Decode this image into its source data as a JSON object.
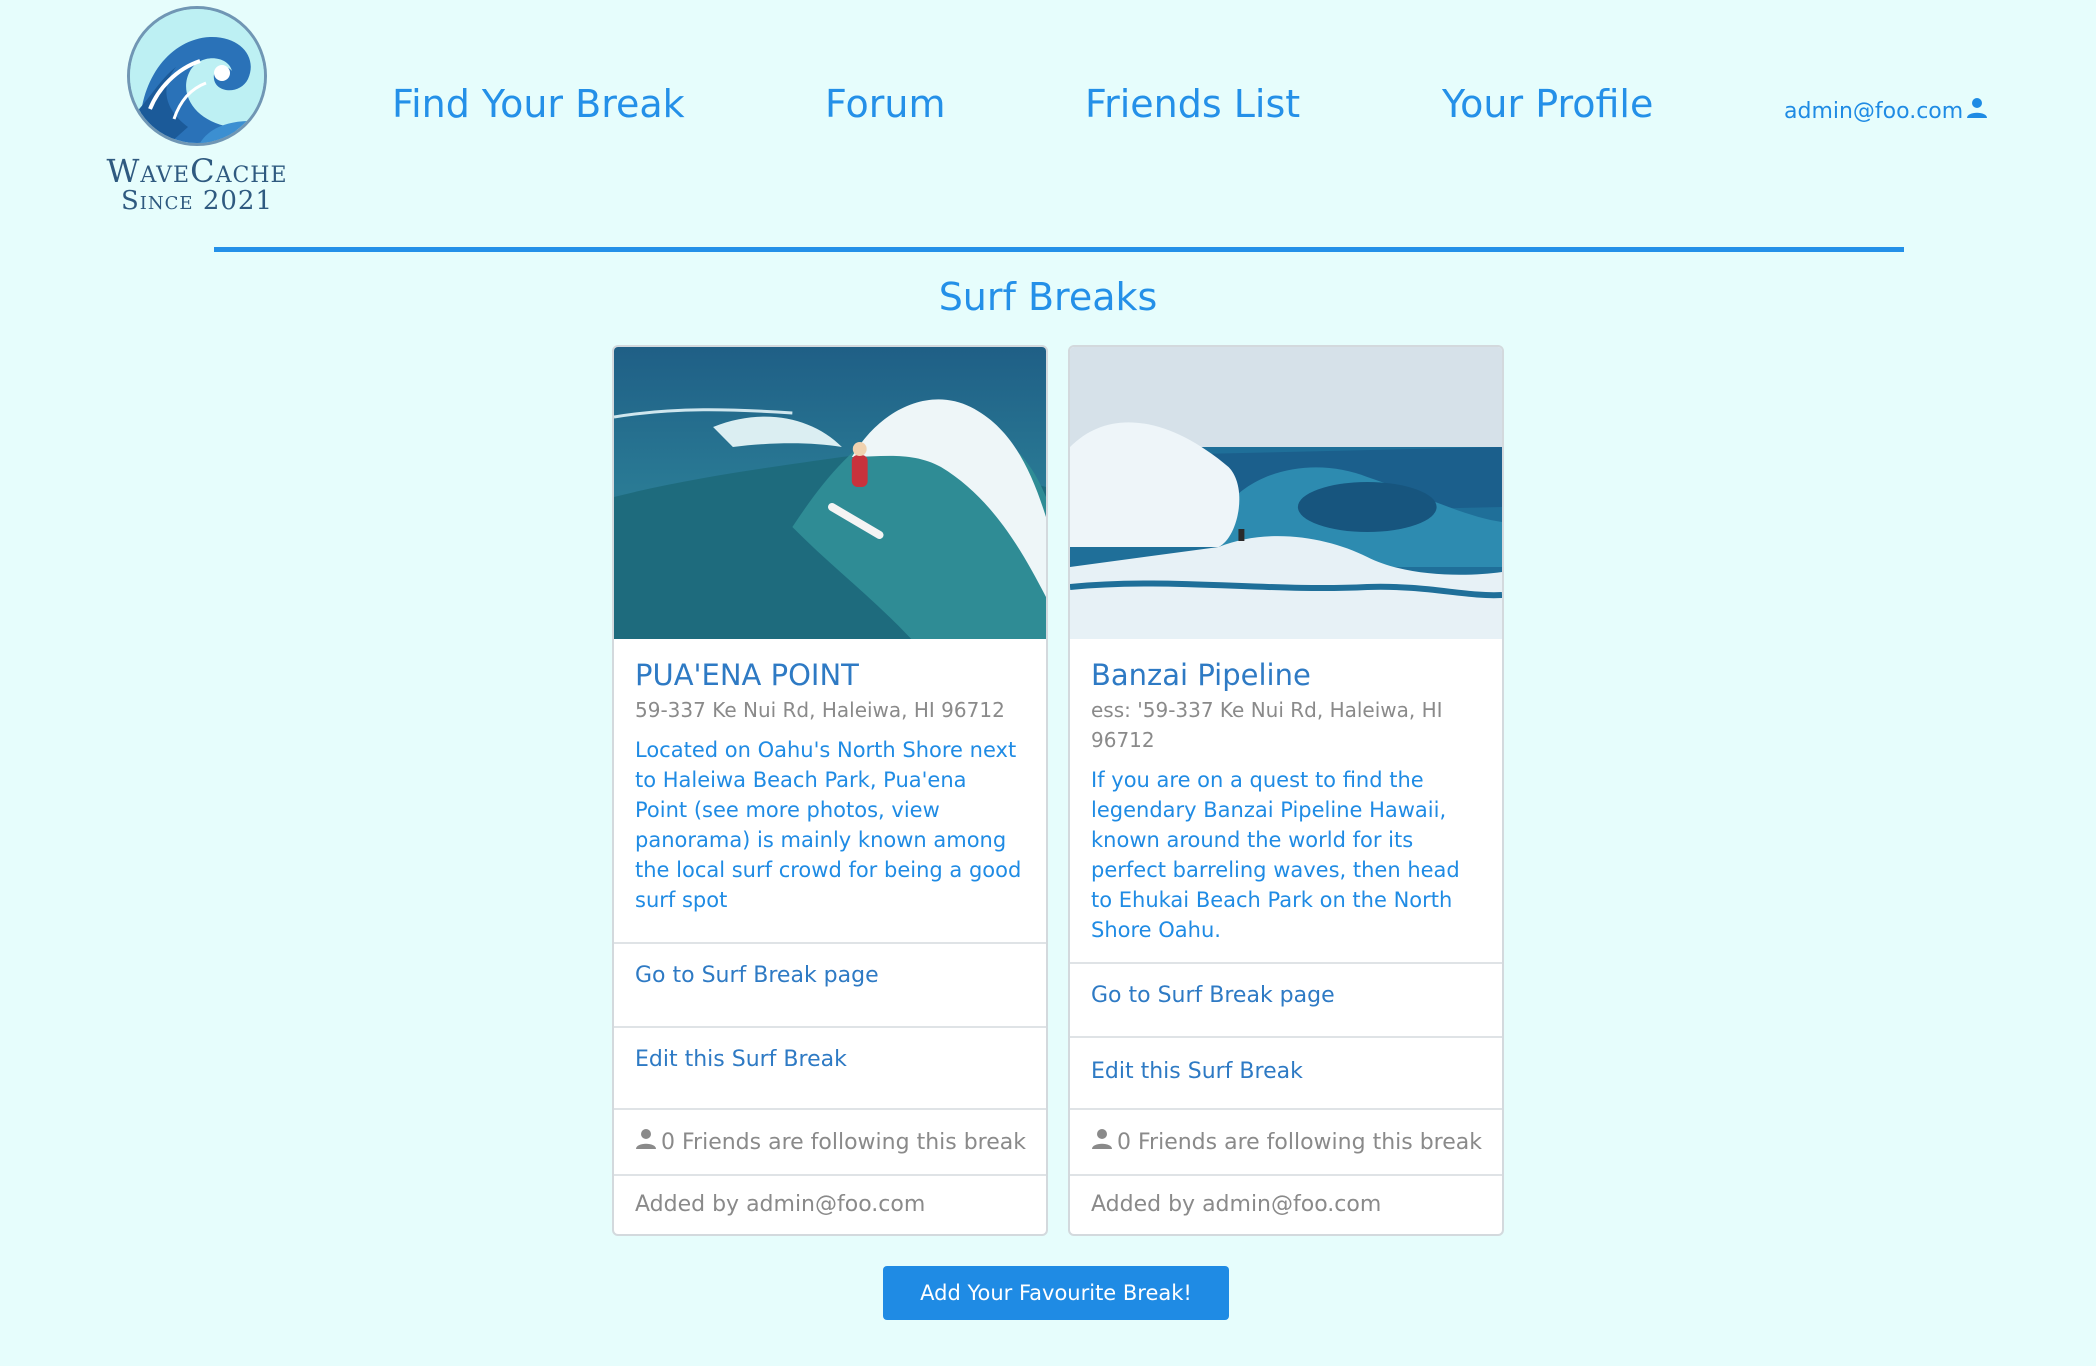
{
  "brand": {
    "name": "WaveCache",
    "tagline": "Since 2021",
    "colors": {
      "primary": "#2490e8",
      "background": "#e6fdfc"
    }
  },
  "nav": {
    "items": [
      {
        "label": "Find Your Break"
      },
      {
        "label": "Forum"
      },
      {
        "label": "Friends List"
      },
      {
        "label": "Your Profile"
      }
    ],
    "user": {
      "email": "admin@foo.com",
      "icon": "user-icon"
    }
  },
  "page": {
    "title": "Surf Breaks"
  },
  "cards": [
    {
      "title": "PUA'ENA POINT",
      "address": "59-337 Ke Nui Rd, Haleiwa, HI 96712",
      "description": "Located on Oahu's North Shore next to Haleiwa Beach Park, Pua'ena Point (see more photos, view panorama) is mainly known among the local surf crowd for being a good surf spot",
      "go_link": "Go to Surf Break page",
      "edit_link": "Edit this Surf Break",
      "followers": "0 Friends are following this break",
      "added_by": "Added by admin@foo.com"
    },
    {
      "title": "Banzai Pipeline",
      "address": "ess: '59-337 Ke Nui Rd, Haleiwa, HI 96712",
      "description": "If you are on a quest to find the legendary Banzai Pipeline Hawaii, known around the world for its perfect barreling waves, then head to Ehukai Beach Park on the North Shore Oahu.",
      "go_link": "Go to Surf Break page",
      "edit_link": "Edit this Surf Break",
      "followers": "0 Friends are following this break",
      "added_by": "Added by admin@foo.com"
    }
  ],
  "actions": {
    "add_break": "Add Your Favourite Break!"
  }
}
